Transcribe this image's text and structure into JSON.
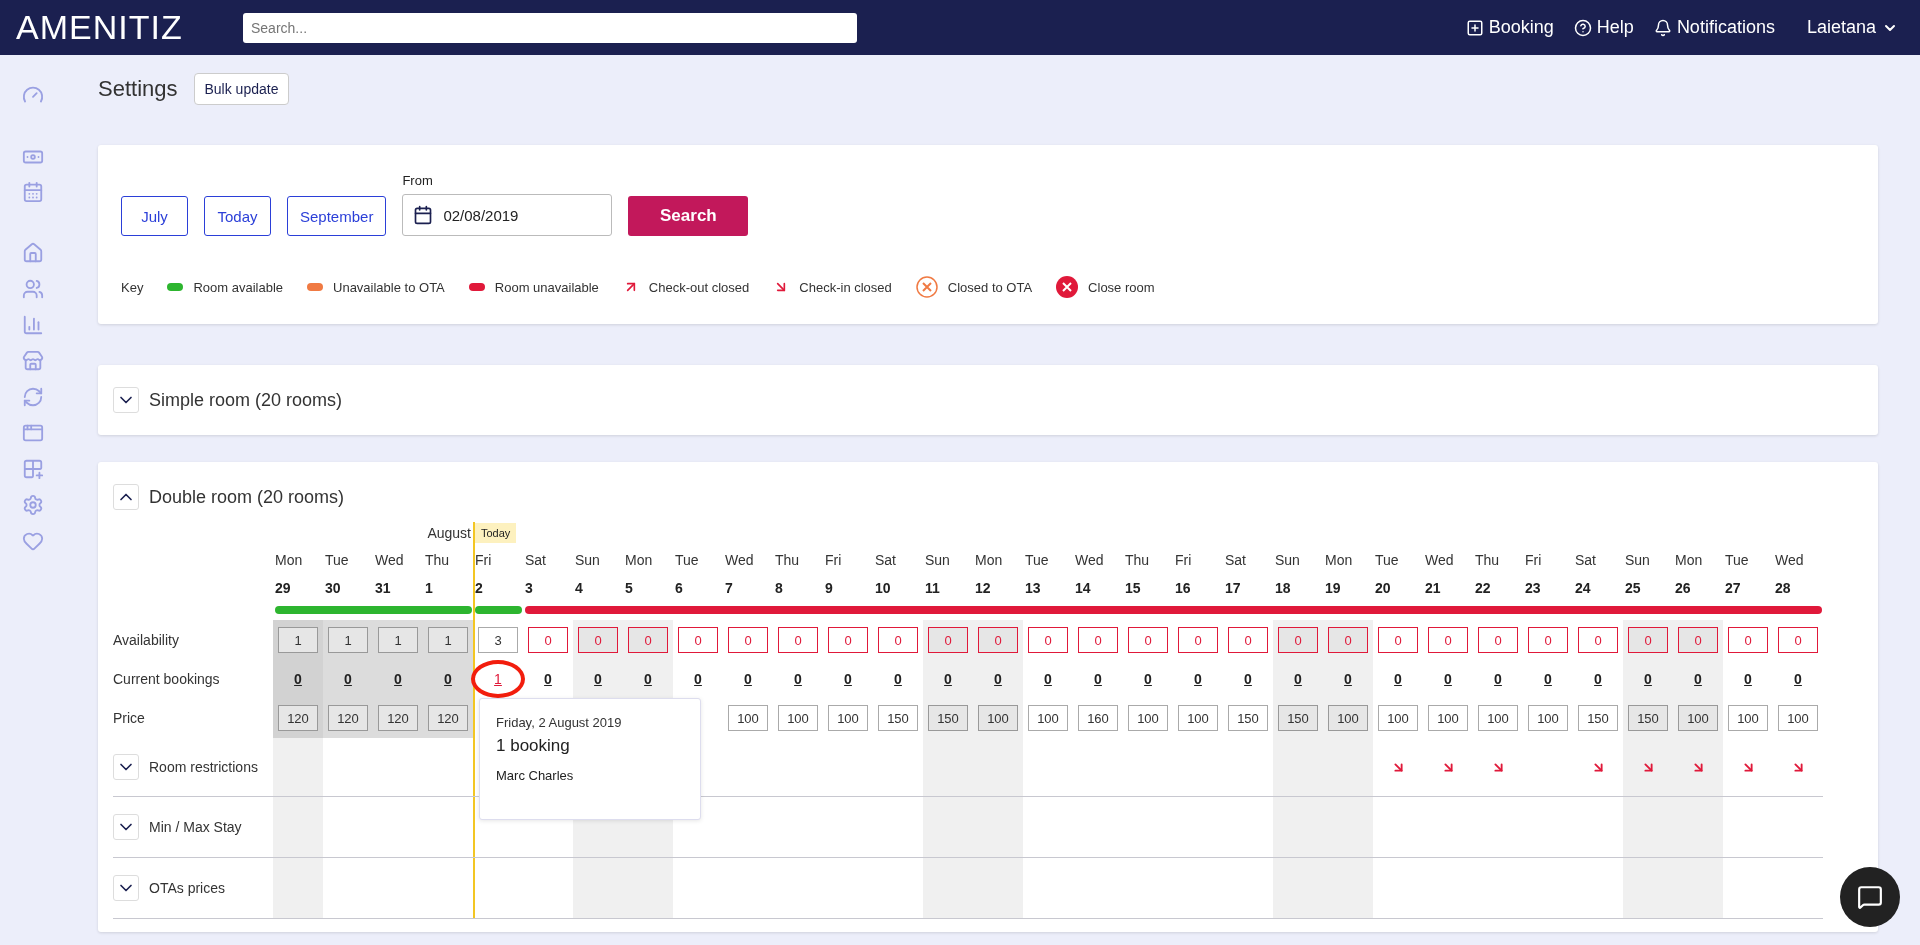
{
  "header": {
    "logo": "AMENITIZ",
    "search": {
      "placeholder": "Search..."
    },
    "actions": [
      {
        "kind": "booking",
        "label": "Booking"
      },
      {
        "kind": "help",
        "label": "Help"
      },
      {
        "kind": "notifications",
        "label": "Notifications"
      }
    ],
    "user": "Laietana"
  },
  "page": {
    "title": "Settings",
    "bulk_button": "Bulk update"
  },
  "filters": {
    "buttons": [
      "July",
      "Today",
      "September"
    ],
    "from": {
      "label": "From",
      "value": "02/08/2019"
    },
    "search_button": "Search"
  },
  "key": {
    "title": "Key",
    "items": [
      {
        "kind": "bar",
        "color": "#2db52f",
        "label": "Room available"
      },
      {
        "kind": "bar",
        "color": "#f07a43",
        "label": "Unavailable to OTA"
      },
      {
        "kind": "bar",
        "color": "#e0193a",
        "label": "Room unavailable"
      },
      {
        "kind": "arrow-up",
        "color": "#e0193a",
        "label": "Check-out closed"
      },
      {
        "kind": "arrow-down",
        "color": "#e0193a",
        "label": "Check-in closed"
      },
      {
        "kind": "ring",
        "color": "#f07a43",
        "label": "Closed to OTA"
      },
      {
        "kind": "disc",
        "color": "#e0193a",
        "label": "Close room"
      }
    ]
  },
  "rooms": [
    {
      "title": "Simple room (20 rooms)",
      "expanded": false
    },
    {
      "title": "Double room (20 rooms)",
      "expanded": true,
      "today_badge": "Today",
      "row_labels": [
        "Availability",
        "Current bookings",
        "Price"
      ],
      "days": [
        {
          "weekday": "Mon",
          "date": "29",
          "color": "#2db52f",
          "unavailable": false,
          "past": true,
          "shaded": true,
          "today": false,
          "availability": "1",
          "bookings": "0",
          "price": "120",
          "checkin_closed": false,
          "highlighted": false
        },
        {
          "weekday": "Tue",
          "date": "30",
          "color": "#2db52f",
          "unavailable": false,
          "past": true,
          "shaded": false,
          "today": false,
          "availability": "1",
          "bookings": "0",
          "price": "120",
          "checkin_closed": false,
          "highlighted": false
        },
        {
          "weekday": "Wed",
          "date": "31",
          "color": "#2db52f",
          "unavailable": false,
          "past": true,
          "shaded": false,
          "today": false,
          "availability": "1",
          "bookings": "0",
          "price": "120",
          "checkin_closed": false,
          "highlighted": false
        },
        {
          "weekday": "Thu",
          "date": "1",
          "month": "August",
          "color": "#2db52f",
          "unavailable": false,
          "past": true,
          "shaded": false,
          "today": false,
          "availability": "1",
          "bookings": "0",
          "price": "120",
          "checkin_closed": false,
          "highlighted": false
        },
        {
          "weekday": "Fri",
          "date": "2",
          "color": "#2db52f",
          "unavailable": false,
          "past": false,
          "shaded": false,
          "today": true,
          "availability": "3",
          "bookings": "1",
          "checkin_closed": false,
          "highlighted": true
        },
        {
          "weekday": "Sat",
          "date": "3",
          "color": "#e0193a",
          "unavailable": true,
          "past": false,
          "shaded": false,
          "today": false,
          "availability": "0",
          "bookings": "0",
          "checkin_closed": false,
          "highlighted": false
        },
        {
          "weekday": "Sun",
          "date": "4",
          "color": "#e0193a",
          "unavailable": true,
          "past": false,
          "shaded": true,
          "today": false,
          "availability": "0",
          "bookings": "0",
          "checkin_closed": false,
          "highlighted": false
        },
        {
          "weekday": "Mon",
          "date": "5",
          "color": "#e0193a",
          "unavailable": true,
          "past": false,
          "shaded": true,
          "today": false,
          "availability": "0",
          "bookings": "0",
          "checkin_closed": false,
          "highlighted": false
        },
        {
          "weekday": "Tue",
          "date": "6",
          "color": "#e0193a",
          "unavailable": true,
          "past": false,
          "shaded": false,
          "today": false,
          "availability": "0",
          "bookings": "0",
          "checkin_closed": false,
          "highlighted": false
        },
        {
          "weekday": "Wed",
          "date": "7",
          "color": "#e0193a",
          "unavailable": true,
          "past": false,
          "shaded": false,
          "today": false,
          "availability": "0",
          "bookings": "0",
          "price": "100",
          "checkin_closed": false,
          "highlighted": false
        },
        {
          "weekday": "Thu",
          "date": "8",
          "color": "#e0193a",
          "unavailable": true,
          "past": false,
          "shaded": false,
          "today": false,
          "availability": "0",
          "bookings": "0",
          "price": "100",
          "checkin_closed": false,
          "highlighted": false
        },
        {
          "weekday": "Fri",
          "date": "9",
          "color": "#e0193a",
          "unavailable": true,
          "past": false,
          "shaded": false,
          "today": false,
          "availability": "0",
          "bookings": "0",
          "price": "100",
          "checkin_closed": false,
          "highlighted": false
        },
        {
          "weekday": "Sat",
          "date": "10",
          "color": "#e0193a",
          "unavailable": true,
          "past": false,
          "shaded": false,
          "today": false,
          "availability": "0",
          "bookings": "0",
          "price": "150",
          "checkin_closed": false,
          "highlighted": false
        },
        {
          "weekday": "Sun",
          "date": "11",
          "color": "#e0193a",
          "unavailable": true,
          "past": false,
          "shaded": true,
          "today": false,
          "availability": "0",
          "bookings": "0",
          "price": "150",
          "checkin_closed": false,
          "highlighted": false
        },
        {
          "weekday": "Mon",
          "date": "12",
          "color": "#e0193a",
          "unavailable": true,
          "past": false,
          "shaded": true,
          "today": false,
          "availability": "0",
          "bookings": "0",
          "price": "100",
          "checkin_closed": false,
          "highlighted": false
        },
        {
          "weekday": "Tue",
          "date": "13",
          "color": "#e0193a",
          "unavailable": true,
          "past": false,
          "shaded": false,
          "today": false,
          "availability": "0",
          "bookings": "0",
          "price": "100",
          "checkin_closed": false,
          "highlighted": false
        },
        {
          "weekday": "Wed",
          "date": "14",
          "color": "#e0193a",
          "unavailable": true,
          "past": false,
          "shaded": false,
          "today": false,
          "availability": "0",
          "bookings": "0",
          "price": "160",
          "checkin_closed": false,
          "highlighted": false
        },
        {
          "weekday": "Thu",
          "date": "15",
          "color": "#e0193a",
          "unavailable": true,
          "past": false,
          "shaded": false,
          "today": false,
          "availability": "0",
          "bookings": "0",
          "price": "100",
          "checkin_closed": false,
          "highlighted": false
        },
        {
          "weekday": "Fri",
          "date": "16",
          "color": "#e0193a",
          "unavailable": true,
          "past": false,
          "shaded": false,
          "today": false,
          "availability": "0",
          "bookings": "0",
          "price": "100",
          "checkin_closed": false,
          "highlighted": false
        },
        {
          "weekday": "Sat",
          "date": "17",
          "color": "#e0193a",
          "unavailable": true,
          "past": false,
          "shaded": false,
          "today": false,
          "availability": "0",
          "bookings": "0",
          "price": "150",
          "checkin_closed": false,
          "highlighted": false
        },
        {
          "weekday": "Sun",
          "date": "18",
          "color": "#e0193a",
          "unavailable": true,
          "past": false,
          "shaded": true,
          "today": false,
          "availability": "0",
          "bookings": "0",
          "price": "150",
          "checkin_closed": false,
          "highlighted": false
        },
        {
          "weekday": "Mon",
          "date": "19",
          "color": "#e0193a",
          "unavailable": true,
          "past": false,
          "shaded": true,
          "today": false,
          "availability": "0",
          "bookings": "0",
          "price": "100",
          "checkin_closed": false,
          "highlighted": false
        },
        {
          "weekday": "Tue",
          "date": "20",
          "color": "#e0193a",
          "unavailable": true,
          "past": false,
          "shaded": false,
          "today": false,
          "availability": "0",
          "bookings": "0",
          "price": "100",
          "checkin_closed": true,
          "highlighted": false
        },
        {
          "weekday": "Wed",
          "date": "21",
          "color": "#e0193a",
          "unavailable": true,
          "past": false,
          "shaded": false,
          "today": false,
          "availability": "0",
          "bookings": "0",
          "price": "100",
          "checkin_closed": true,
          "highlighted": false
        },
        {
          "weekday": "Thu",
          "date": "22",
          "color": "#e0193a",
          "unavailable": true,
          "past": false,
          "shaded": false,
          "today": false,
          "availability": "0",
          "bookings": "0",
          "price": "100",
          "checkin_closed": true,
          "highlighted": false
        },
        {
          "weekday": "Fri",
          "date": "23",
          "color": "#e0193a",
          "unavailable": true,
          "past": false,
          "shaded": false,
          "today": false,
          "availability": "0",
          "bookings": "0",
          "price": "100",
          "checkin_closed": false,
          "highlighted": false
        },
        {
          "weekday": "Sat",
          "date": "24",
          "color": "#e0193a",
          "unavailable": true,
          "past": false,
          "shaded": false,
          "today": false,
          "availability": "0",
          "bookings": "0",
          "price": "150",
          "checkin_closed": true,
          "highlighted": false
        },
        {
          "weekday": "Sun",
          "date": "25",
          "color": "#e0193a",
          "unavailable": true,
          "past": false,
          "shaded": true,
          "today": false,
          "availability": "0",
          "bookings": "0",
          "price": "150",
          "checkin_closed": true,
          "highlighted": false
        },
        {
          "weekday": "Mon",
          "date": "26",
          "color": "#e0193a",
          "unavailable": true,
          "past": false,
          "shaded": true,
          "today": false,
          "availability": "0",
          "bookings": "0",
          "price": "100",
          "checkin_closed": true,
          "highlighted": false
        },
        {
          "weekday": "Tue",
          "date": "27",
          "color": "#e0193a",
          "unavailable": true,
          "past": false,
          "shaded": false,
          "today": false,
          "availability": "0",
          "bookings": "0",
          "price": "100",
          "checkin_closed": true,
          "highlighted": false
        },
        {
          "weekday": "Wed",
          "date": "28",
          "color": "#e0193a",
          "unavailable": true,
          "past": false,
          "shaded": false,
          "today": false,
          "availability": "0",
          "bookings": "0",
          "price": "100",
          "checkin_closed": true,
          "highlighted": false
        }
      ],
      "sections": [
        {
          "title": "Room restrictions",
          "expanded": false
        },
        {
          "title": "Min / Max Stay",
          "expanded": false
        },
        {
          "title": "OTAs prices",
          "expanded": false
        }
      ],
      "tooltip": {
        "date": "Friday, 2 August 2019",
        "title": "1 booking",
        "guests": [
          "Marc Charles"
        ]
      }
    }
  ]
}
